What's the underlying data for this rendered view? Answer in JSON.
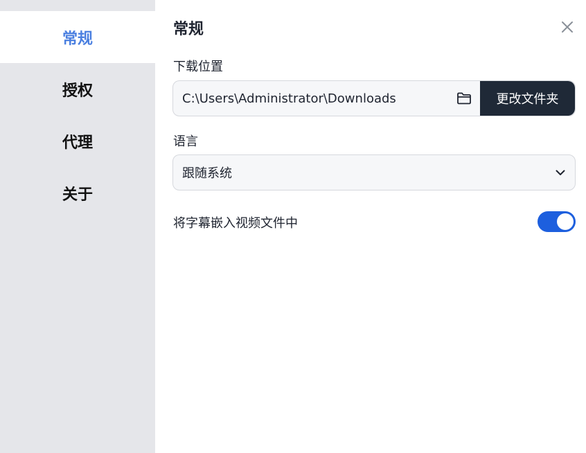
{
  "sidebar": {
    "items": [
      {
        "label": "常规",
        "active": true
      },
      {
        "label": "授权",
        "active": false
      },
      {
        "label": "代理",
        "active": false
      },
      {
        "label": "关于",
        "active": false
      }
    ]
  },
  "header": {
    "title": "常规",
    "close_icon": "close-icon"
  },
  "download": {
    "label": "下载位置",
    "path": "C:\\Users\\Administrator\\Downloads",
    "folder_icon": "folder-icon",
    "change_button": "更改文件夹"
  },
  "language": {
    "label": "语言",
    "selected": "跟随系统",
    "chevron_icon": "chevron-down-icon"
  },
  "subtitle_embed": {
    "label": "将字幕嵌入视频文件中",
    "enabled": true
  },
  "colors": {
    "accent": "#4a7fe0",
    "toggle_on": "#1d5fde",
    "button_dark": "#1f2937",
    "sidebar_bg": "#e5e6ea"
  }
}
